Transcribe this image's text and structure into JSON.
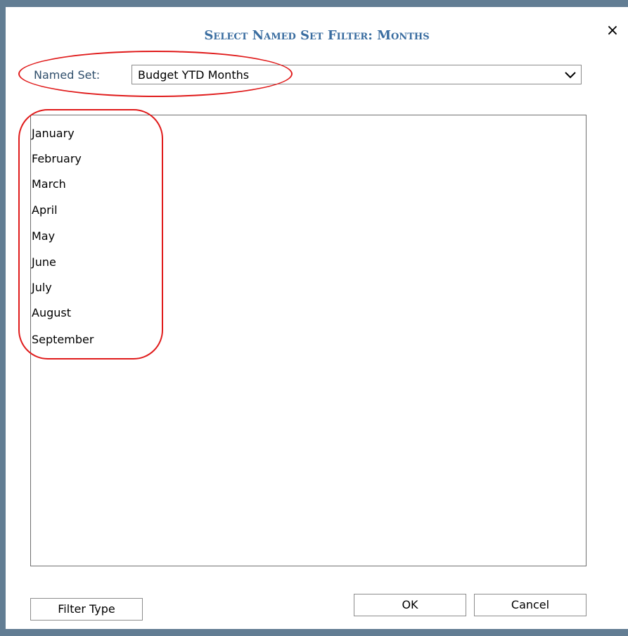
{
  "dialog": {
    "title": "Select Named Set Filter: Months",
    "close_icon": "×"
  },
  "named_set": {
    "label": "Named Set:",
    "value": "Budget YTD Months"
  },
  "months": [
    "January",
    "February",
    "March",
    "April",
    "May",
    "June",
    "July",
    "August",
    "September"
  ],
  "buttons": {
    "filter_type": "Filter Type",
    "ok": "OK",
    "cancel": "Cancel"
  },
  "colors": {
    "title": "#3a6da0",
    "annotation": "#e01b1b",
    "window_frame": "#627d93"
  }
}
